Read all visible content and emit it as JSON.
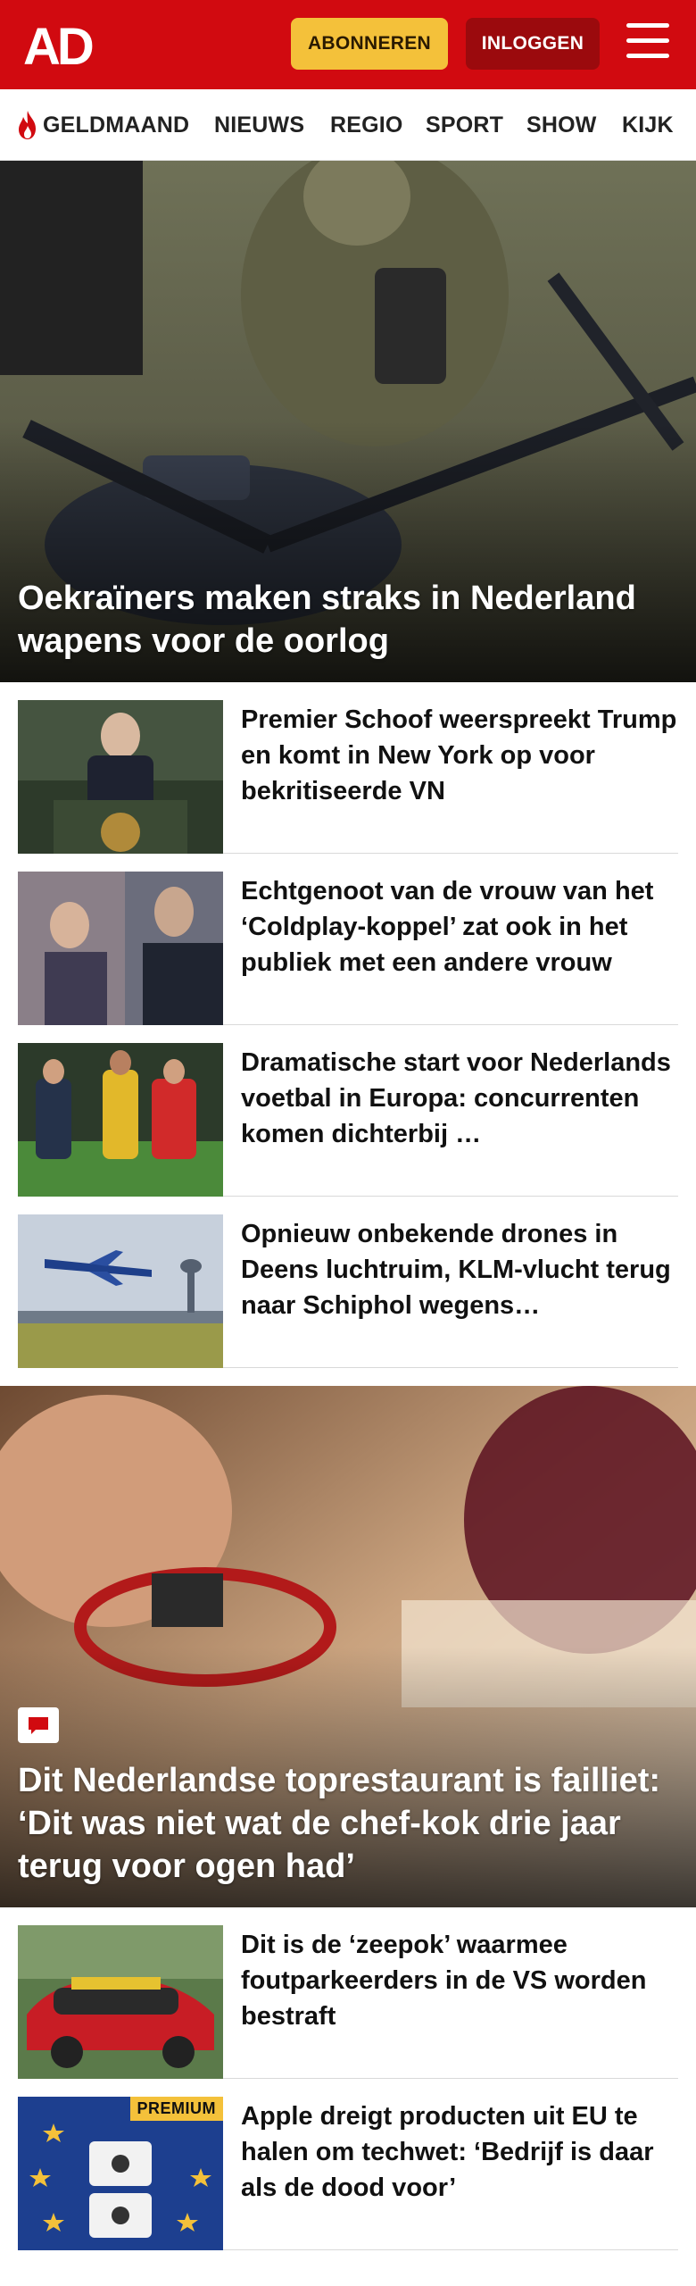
{
  "header": {
    "logo": "AD",
    "subscribe_label": "ABONNEREN",
    "login_label": "INLOGGEN",
    "brand_color": "#d10a10",
    "accent_color": "#f4c13a"
  },
  "nav": {
    "items": [
      {
        "label": "GELDMAAND",
        "icon": "flame-icon"
      },
      {
        "label": "NIEUWS"
      },
      {
        "label": "REGIO"
      },
      {
        "label": "SPORT"
      },
      {
        "label": "SHOW"
      },
      {
        "label": "KIJK"
      }
    ]
  },
  "articles": {
    "hero1": {
      "title": "Oekraïners maken straks in Nederland wapens voor de oorlog"
    },
    "list1": [
      {
        "title": "Premier Schoof weerspreekt Trump en komt in New York op voor bekritiseerde VN"
      },
      {
        "title": "Echtgenoot van de vrouw van het ‘Coldplay-koppel’ zat ook in het publiek met een andere vrouw"
      },
      {
        "title": "Dramatische start voor Nederlands voetbal in Europa: concurrenten komen dichterbij …"
      },
      {
        "title": "Opnieuw onbekende drones in Deens luchtruim, KLM-vlucht terug naar Schiphol wegens…"
      }
    ],
    "hero2": {
      "title": "Dit Nederlandse toprestaurant is failliet: ‘Dit was niet wat de chef-kok drie jaar terug voor ogen had’",
      "icon": "comment-icon"
    },
    "list2": [
      {
        "title": "Dit is de ‘zeepok’ waarmee foutparkeerders in de VS worden bestraft"
      },
      {
        "title": "Apple dreigt producten uit EU te halen om techwet: ‘Bedrijf is daar als de dood voor’",
        "badge": "PREMIUM"
      }
    ]
  }
}
